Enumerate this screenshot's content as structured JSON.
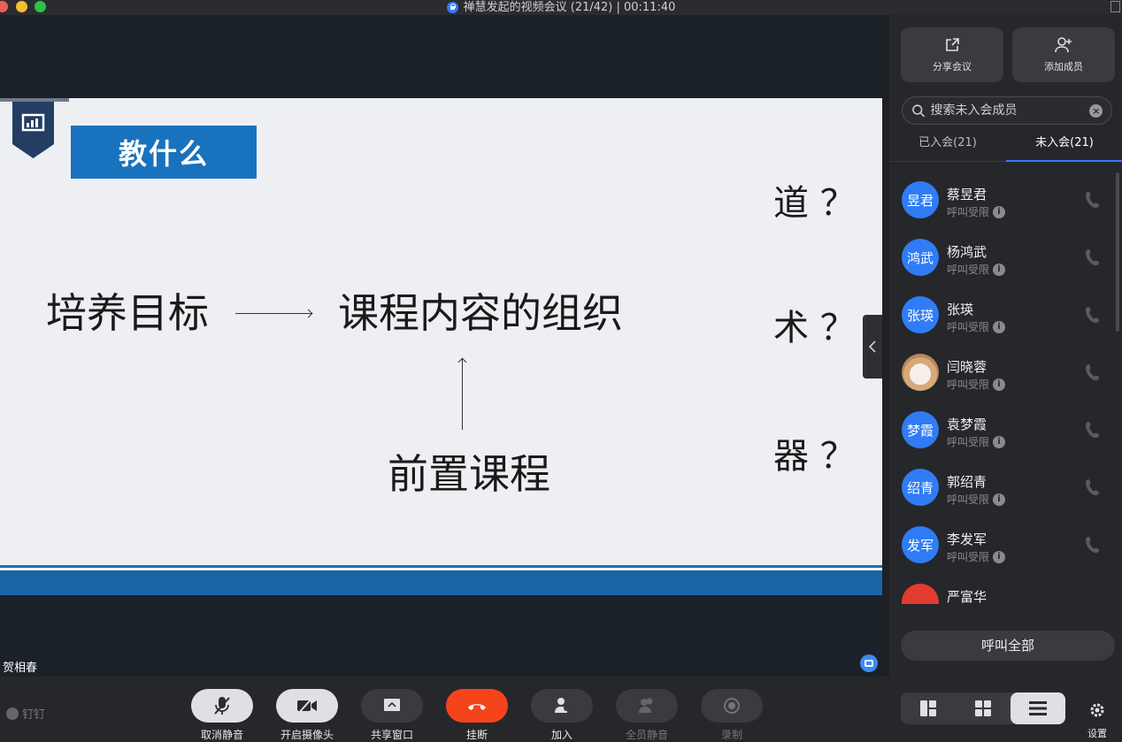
{
  "window": {
    "title": "禅慧发起的视频会议 (21/42) | 00:11:40"
  },
  "slide": {
    "heading": "教什么",
    "left_text": "培养目标",
    "center_text": "课程内容的组织",
    "bottom_text": "前置课程",
    "q1": "道 ？",
    "q2": "术 ？",
    "q3": "器 ？"
  },
  "speaker": {
    "name": "贺相春"
  },
  "brand": {
    "name": "钉钉"
  },
  "toolbar": {
    "mute": "取消静音",
    "camera": "开启摄像头",
    "share": "共享窗口",
    "hangup": "挂断",
    "join": "加入",
    "mute_all": "全员静音",
    "record": "录制",
    "view_speaker": "演讲",
    "view_grid": "宫格",
    "view_list": "列表",
    "settings": "设置"
  },
  "panel": {
    "share_meeting": "分享会议",
    "add_member": "添加成员",
    "search_placeholder": "搜索未入会成员",
    "tab_joined": "已入会(21)",
    "tab_not_joined": "未入会(21)",
    "call_all": "呼叫全部",
    "members": [
      {
        "avatar": "昱君",
        "name": "蔡昱君",
        "status": "呼叫受限"
      },
      {
        "avatar": "鸿武",
        "name": "杨鸿武",
        "status": "呼叫受限"
      },
      {
        "avatar": "张瑛",
        "name": "张瑛",
        "status": "呼叫受限"
      },
      {
        "avatar": "",
        "name": "闫晓蓉",
        "status": "呼叫受限"
      },
      {
        "avatar": "梦霞",
        "name": "袁梦霞",
        "status": "呼叫受限"
      },
      {
        "avatar": "绍青",
        "name": "郭绍青",
        "status": "呼叫受限"
      },
      {
        "avatar": "发军",
        "name": "李发军",
        "status": "呼叫受限"
      },
      {
        "avatar": "",
        "name": "严富华",
        "status": ""
      }
    ]
  },
  "colors": {
    "accent": "#2f7cf6",
    "hangup": "#f5441b",
    "slide_blue": "#1972bd"
  }
}
